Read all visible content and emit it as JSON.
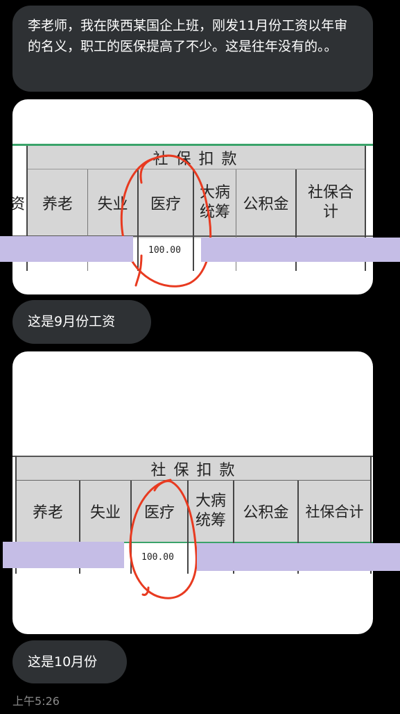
{
  "messages": {
    "question": "李老师，我在陕西某国企上班，刚发11月份工资以年审的名义，职工的医保提高了不少。这是往年没有的。。",
    "caption_sep": "这是9月份工资",
    "caption_oct": "这是10月份"
  },
  "image_sep": {
    "group_header": "社 保 扣 款",
    "partial_left": "资",
    "columns": [
      "养老",
      "失业",
      "医疗",
      "大病\n统筹",
      "公积金",
      "社保合\n计"
    ],
    "medical_value": "100.00"
  },
  "image_oct": {
    "group_header": "社 保 扣 款",
    "columns": [
      "养老",
      "失业",
      "医疗",
      "大病\n统筹",
      "公积金",
      "社保合计"
    ],
    "medical_value": "100.00"
  },
  "timestamp": "上午5:26",
  "colors": {
    "bubble": "#2e3134",
    "table_header": "#d6d6d6",
    "redaction": "#c5bde6",
    "annotation": "#e83a20"
  }
}
